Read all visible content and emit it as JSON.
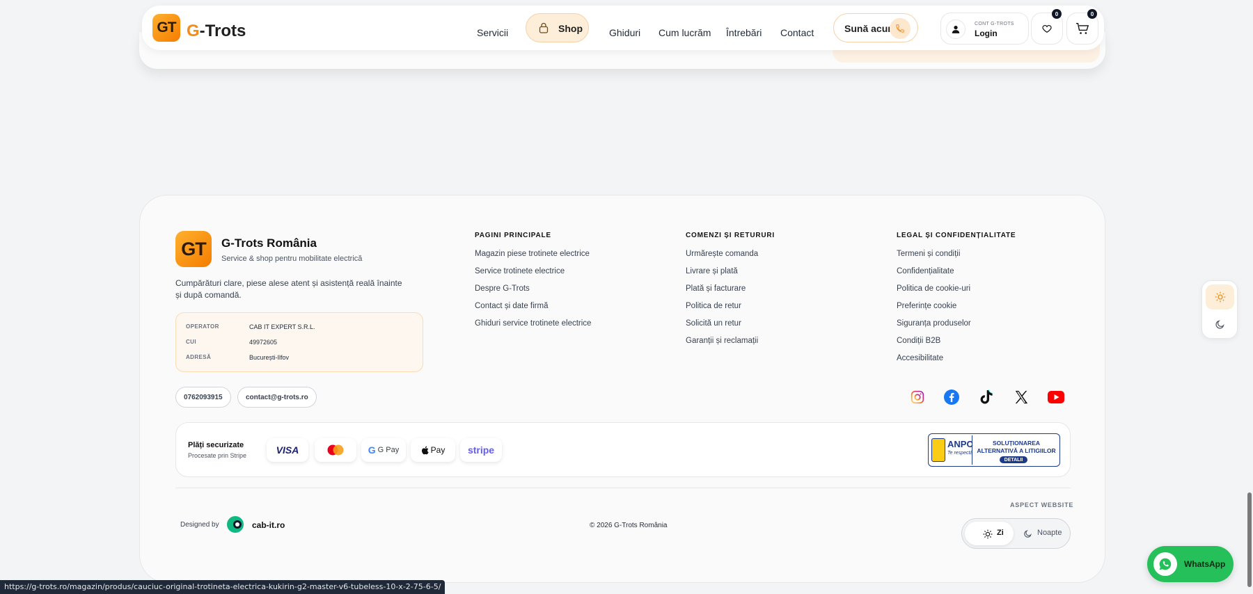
{
  "header": {
    "logo_text": "GT",
    "brand_g": "G",
    "brand_rest": "-Trots",
    "nav": [
      "Servicii",
      "Shop",
      "Ghiduri",
      "Cum lucrăm",
      "Întrebări",
      "Contact"
    ],
    "call_label": "Sună acum",
    "account_small": "CONT G-TROTS",
    "account_label": "Login",
    "wishlist_count": "0",
    "cart_count": "0"
  },
  "footer": {
    "logo_text": "GT",
    "name": "G-Trots România",
    "tagline": "Service & shop pentru mobilitate electrică",
    "description": "Cumpărături clare, piese alese atent și asistență reală înainte și după comandă.",
    "operator": [
      {
        "key": "OPERATOR",
        "value": "CAB IT EXPERT S.R.L."
      },
      {
        "key": "CUI",
        "value": "49972605"
      },
      {
        "key": "ADRESĂ",
        "value": "București-Ilfov"
      }
    ],
    "phone": "0762093915",
    "email": "contact@g-trots.ro",
    "columns": [
      {
        "title": "PAGINI PRINCIPALE",
        "links": [
          "Magazin piese trotinete electrice",
          "Service trotinete electrice",
          "Despre G-Trots",
          "Contact și date firmă",
          "Ghiduri service trotinete electrice"
        ]
      },
      {
        "title": "COMENZI ȘI RETURURI",
        "links": [
          "Urmărește comanda",
          "Livrare și plată",
          "Plată și facturare",
          "Politica de retur",
          "Solicită un retur",
          "Garanții și reclamații"
        ]
      },
      {
        "title": "LEGAL ȘI CONFIDENȚIALITATE",
        "links": [
          "Termeni și condiții",
          "Confidențialitate",
          "Politica de cookie-uri",
          "Preferințe cookie",
          "Siguranța produselor",
          "Condiții B2B",
          "Accesibilitate"
        ]
      }
    ],
    "social": [
      "instagram-icon",
      "facebook-icon",
      "tiktok-icon",
      "x-icon",
      "youtube-icon"
    ],
    "payments": {
      "title": "Plăți securizate",
      "subtitle": "Procesate prin Stripe",
      "methods": [
        "VISA",
        "Mastercard",
        "G Pay",
        "Pay",
        "stripe"
      ]
    },
    "anpc": {
      "brand": "ANPC",
      "motto": "Te respectă",
      "text": "SOLUȚIONAREA ALTERNATIVĂ A LITIGIILOR",
      "button": "DETALII"
    },
    "designed_by": "Designed by",
    "designer": "cab-it.ro",
    "copyright": "© 2026 G-Trots România",
    "aspect_title": "ASPECT WEBSITE",
    "theme_day": "Zi",
    "theme_night": "Noapte"
  },
  "whatsapp_label": "WhatsApp",
  "status_url": "https://g-trots.ro/magazin/produs/cauciuc-original-trotineta-electrica-kukirin-g2-master-v6-tubeless-10-x-2-75-6-5/",
  "colors": {
    "accent": "#f28c1a",
    "whatsapp": "#25c05a",
    "anpc": "#1e3a8a"
  }
}
